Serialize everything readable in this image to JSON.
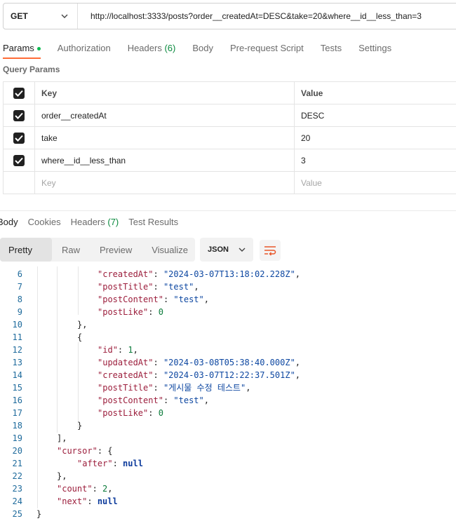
{
  "request": {
    "method": "GET",
    "url": "http://localhost:3333/posts?order__createdAt=DESC&take=20&where__id__less_than=3"
  },
  "request_tabs": [
    {
      "label": "Params",
      "active": true,
      "dot": true
    },
    {
      "label": "Authorization"
    },
    {
      "label": "Headers",
      "count": "(6)"
    },
    {
      "label": "Body"
    },
    {
      "label": "Pre-request Script"
    },
    {
      "label": "Tests"
    },
    {
      "label": "Settings"
    }
  ],
  "query_params": {
    "title": "Query Params",
    "header": {
      "key": "Key",
      "value": "Value"
    },
    "rows": [
      {
        "key": "order__createdAt",
        "value": "DESC",
        "checked": true
      },
      {
        "key": "take",
        "value": "20",
        "checked": true
      },
      {
        "key": "where__id__less_than",
        "value": "3",
        "checked": true
      }
    ],
    "placeholder": {
      "key": "Key",
      "value": "Value"
    }
  },
  "response_tabs": [
    {
      "label": "Body",
      "active": true
    },
    {
      "label": "Cookies"
    },
    {
      "label": "Headers",
      "count": "(7)"
    },
    {
      "label": "Test Results"
    }
  ],
  "view_modes": [
    "Pretty",
    "Raw",
    "Preview",
    "Visualize"
  ],
  "active_view": "Pretty",
  "format": "JSON",
  "code_lines": [
    {
      "n": "6",
      "indent": 3,
      "key": "createdAt",
      "val": "\"2024-03-07T13:18:02.228Z\"",
      "t": "str",
      "comma": true
    },
    {
      "n": "7",
      "indent": 3,
      "key": "postTitle",
      "val": "\"test\"",
      "t": "str",
      "comma": true
    },
    {
      "n": "8",
      "indent": 3,
      "key": "postContent",
      "val": "\"test\"",
      "t": "str",
      "comma": true
    },
    {
      "n": "9",
      "indent": 3,
      "key": "postLike",
      "val": "0",
      "t": "num",
      "comma": false
    },
    {
      "n": "10",
      "indent": 2,
      "raw": "},"
    },
    {
      "n": "11",
      "indent": 2,
      "raw": "{"
    },
    {
      "n": "12",
      "indent": 3,
      "key": "id",
      "val": "1",
      "t": "num",
      "comma": true
    },
    {
      "n": "13",
      "indent": 3,
      "key": "updatedAt",
      "val": "\"2024-03-08T05:38:40.000Z\"",
      "t": "str",
      "comma": true
    },
    {
      "n": "14",
      "indent": 3,
      "key": "createdAt",
      "val": "\"2024-03-07T12:22:37.501Z\"",
      "t": "str",
      "comma": true
    },
    {
      "n": "15",
      "indent": 3,
      "key": "postTitle",
      "val": "\"게시물 수정 테스트\"",
      "t": "str",
      "comma": true
    },
    {
      "n": "16",
      "indent": 3,
      "key": "postContent",
      "val": "\"test\"",
      "t": "str",
      "comma": true
    },
    {
      "n": "17",
      "indent": 3,
      "key": "postLike",
      "val": "0",
      "t": "num",
      "comma": false
    },
    {
      "n": "18",
      "indent": 2,
      "raw": "}"
    },
    {
      "n": "19",
      "indent": 1,
      "raw": "],"
    },
    {
      "n": "20",
      "indent": 1,
      "key": "cursor",
      "val": "{",
      "t": "raw",
      "comma": false
    },
    {
      "n": "21",
      "indent": 2,
      "key": "after",
      "val": "null",
      "t": "lit",
      "comma": false
    },
    {
      "n": "22",
      "indent": 1,
      "raw": "},"
    },
    {
      "n": "23",
      "indent": 1,
      "key": "count",
      "val": "2",
      "t": "num",
      "comma": true
    },
    {
      "n": "24",
      "indent": 1,
      "key": "next",
      "val": "null",
      "t": "lit",
      "comma": false
    },
    {
      "n": "25",
      "indent": 0,
      "raw": "}"
    }
  ]
}
